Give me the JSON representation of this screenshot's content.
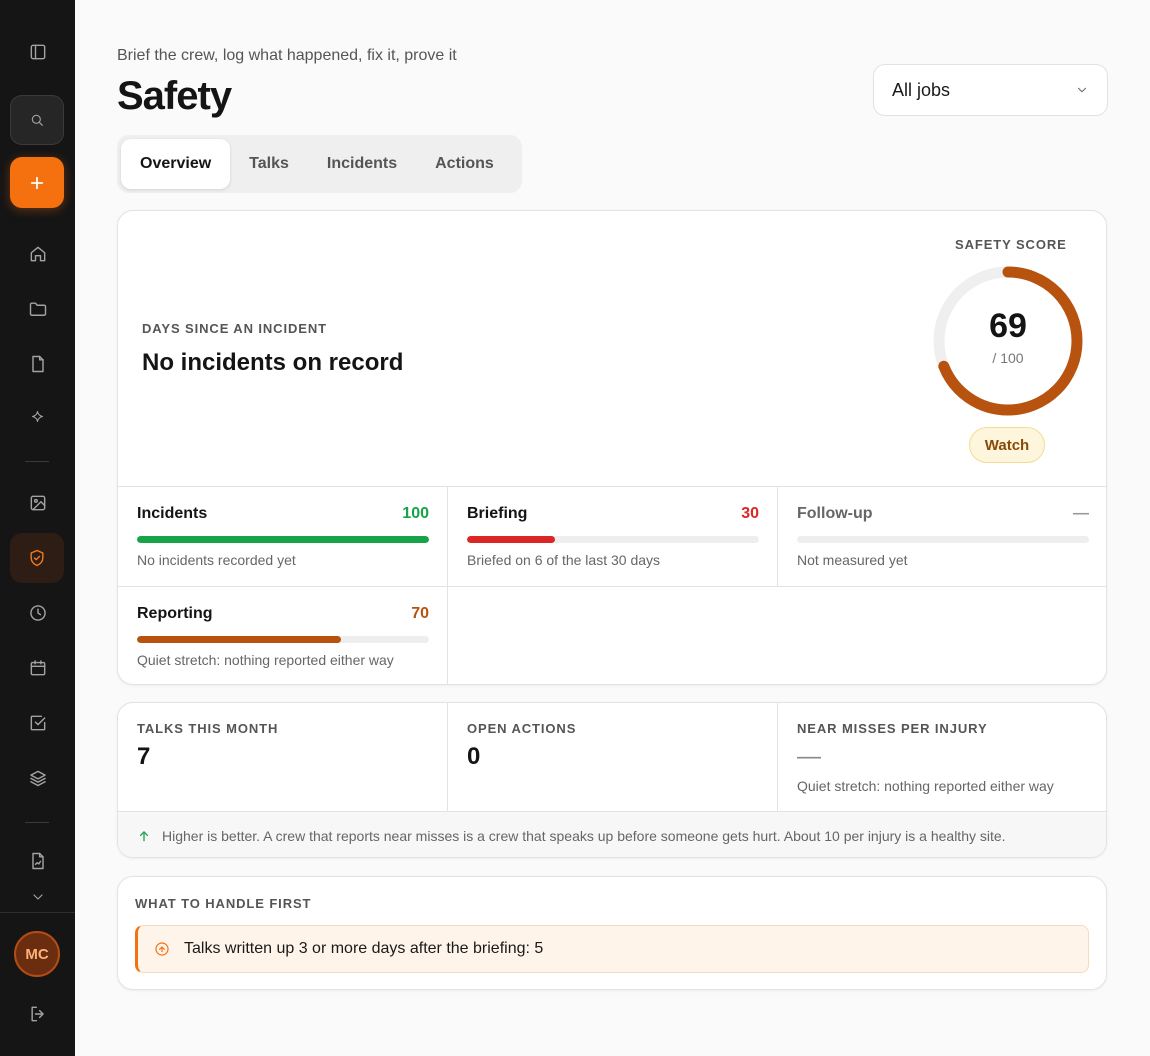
{
  "sidebar": {
    "avatar_initials": "MC",
    "icons": [
      "panel-toggle-icon",
      "search-icon",
      "plus-icon",
      "home-icon",
      "folder-icon",
      "file-icon",
      "sparkle-icon",
      "image-icon",
      "shield-check-icon",
      "clock-icon",
      "calendar-icon",
      "checkbox-icon",
      "layers-icon",
      "file-chart-icon",
      "chevron-down-icon",
      "logout-icon"
    ],
    "active_item": "shield-check-icon",
    "accent_color": "#f5710f"
  },
  "header": {
    "subtitle": "Brief the crew, log what happened, fix it, prove it",
    "title": "Safety",
    "job_filter": {
      "selected": "All jobs"
    }
  },
  "tabs": [
    {
      "label": "Overview",
      "active": true
    },
    {
      "label": "Talks",
      "active": false
    },
    {
      "label": "Incidents",
      "active": false
    },
    {
      "label": "Actions",
      "active": false
    }
  ],
  "overview": {
    "days_label": "DAYS SINCE AN INCIDENT",
    "days_text": "No incidents on record",
    "score_label": "SAFETY SCORE",
    "score": "69",
    "score_max": "/ 100",
    "score_fraction": 0.69,
    "score_color": "#b8530f",
    "status": "Watch",
    "metrics": [
      {
        "name": "Incidents",
        "value": "100",
        "fraction": 1.0,
        "color": "#16a34a",
        "desc": "No incidents recorded yet"
      },
      {
        "name": "Briefing",
        "value": "30",
        "fraction": 0.3,
        "color": "#dc2626",
        "desc": "Briefed on 6 of the last 30 days"
      },
      {
        "name": "Follow-up",
        "value": "—",
        "fraction": 0,
        "color": "#999999",
        "desc": "Not measured yet"
      },
      {
        "name": "Reporting",
        "value": "70",
        "fraction": 0.7,
        "color": "#b8530f",
        "desc": "Quiet stretch: nothing reported either way"
      }
    ]
  },
  "stats": {
    "talks_label": "TALKS THIS MONTH",
    "talks_value": "7",
    "actions_label": "OPEN ACTIONS",
    "actions_value": "0",
    "near_label": "NEAR MISSES PER INJURY",
    "near_value": "—",
    "near_note": "Quiet stretch: nothing reported either way",
    "footer": "Higher is better. A crew that reports near misses is a crew that speaks up before someone gets hurt. About 10 per injury is a healthy site."
  },
  "priorities": {
    "label": "WHAT TO HANDLE FIRST",
    "items": [
      "Talks written up 3 or more days after the briefing: 5"
    ]
  }
}
